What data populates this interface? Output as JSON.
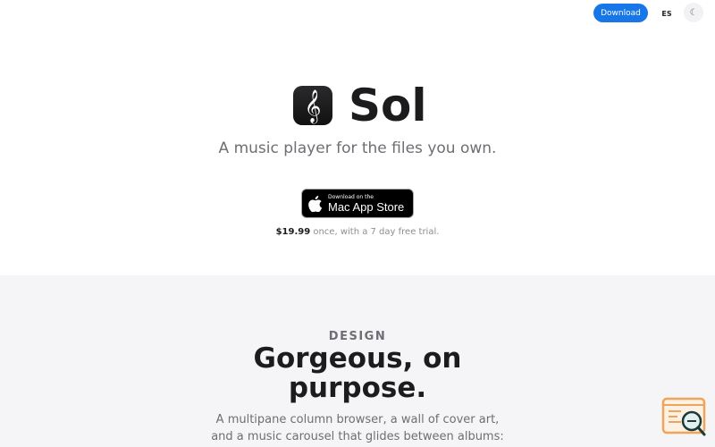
{
  "nav": {
    "download_label": "Download",
    "language_label": "ES",
    "theme_toggle_icon": "moon-icon"
  },
  "hero": {
    "app_name": "Sol",
    "app_icon": "treble-clef-icon",
    "tagline": "A music player for the files you own.",
    "store_badge": {
      "small_label": "Download on the",
      "big_label": "Mac App Store",
      "icon": "apple-icon"
    },
    "price": "$19.99",
    "price_note": " once, with a 7 day free trial."
  },
  "design_section": {
    "eyebrow": "DESIGN",
    "headline": "Gorgeous, on purpose.",
    "body": "A multipane column browser, a wall of cover art, and a music carousel that glides between albums: the"
  },
  "colors": {
    "accent": "#1877e8",
    "section_bg": "#f5f5f7",
    "widget_orange": "#f0a35a"
  }
}
